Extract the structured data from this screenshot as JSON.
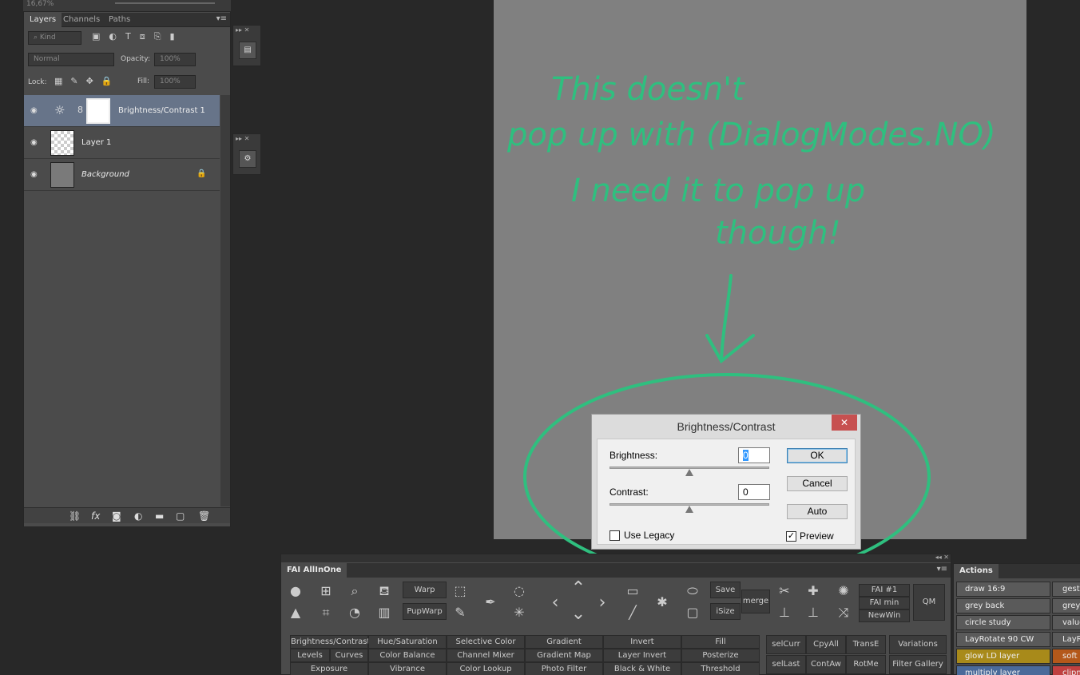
{
  "zoom": "16,67%",
  "layers_panel": {
    "tabs": [
      "Layers",
      "Channels",
      "Paths"
    ],
    "filter_kind": "Kind",
    "blend_mode": "Normal",
    "opacity_label": "Opacity:",
    "opacity_value": "100%",
    "lock_label": "Lock:",
    "fill_label": "Fill:",
    "fill_value": "100%",
    "layers": [
      {
        "name": "Brightness/Contrast 1",
        "selected": true
      },
      {
        "name": "Layer 1",
        "selected": false
      },
      {
        "name": "Background",
        "selected": false
      }
    ]
  },
  "annotation": {
    "lines": [
      "This doesn't",
      "pop up with (DialogModes.NO)",
      "I need it to pop up",
      "though!"
    ],
    "color": "#2fbf7f"
  },
  "dialog": {
    "title": "Brightness/Contrast",
    "brightness_label": "Brightness:",
    "brightness_value": "0",
    "contrast_label": "Contrast:",
    "contrast_value": "0",
    "ok": "OK",
    "cancel": "Cancel",
    "auto": "Auto",
    "legacy_label": "Use Legacy",
    "preview_label": "Preview",
    "preview_checked": "✓"
  },
  "fai_panel": {
    "title": "FAI AllInOne",
    "warp": "Warp",
    "pupwarp": "PupWarp",
    "save": "Save",
    "isize": "iSize",
    "merge": "merge",
    "fai1": "FAI #1",
    "faimin": "FAI min",
    "newwin": "NewWin",
    "qm": "QM",
    "adjust_row1": [
      "Brightness/Contrast",
      "Hue/Saturation",
      "Selective Color",
      "Gradient",
      "Invert",
      "Fill"
    ],
    "adjust_row2a": [
      "Levels",
      "Curves"
    ],
    "adjust_row2": [
      "Color Balance",
      "Channel Mixer",
      "Gradient Map",
      "Layer Invert",
      "Posterize"
    ],
    "adjust_row3": [
      "Exposure",
      "Vibrance",
      "Color Lookup",
      "Photo Filter",
      "Black & White",
      "Threshold"
    ],
    "sel_row1": [
      "selCurr",
      "CpyAll",
      "TransE"
    ],
    "sel_row2": [
      "selLast",
      "ContAw",
      "RotMe"
    ],
    "variations": "Variations",
    "filter_gallery": "Filter Gallery"
  },
  "actions_panel": {
    "title": "Actions",
    "col1": [
      "draw 16:9",
      "grey back",
      "circle study",
      "LayRotate 90 CW",
      "glow LD layer",
      "multiply layer"
    ],
    "col2": [
      "gestu",
      "grey",
      "value",
      "LayR",
      "soft li",
      "clipm"
    ],
    "col1_colors": [
      "#5a5a5a",
      "#5a5a5a",
      "#5a5a5a",
      "#5a5a5a",
      "#a88a1a",
      "#4a6a9a"
    ],
    "col2_colors": [
      "#5a5a5a",
      "#5a5a5a",
      "#5a5a5a",
      "#5a5a5a",
      "#b4581a",
      "#c04040"
    ]
  }
}
